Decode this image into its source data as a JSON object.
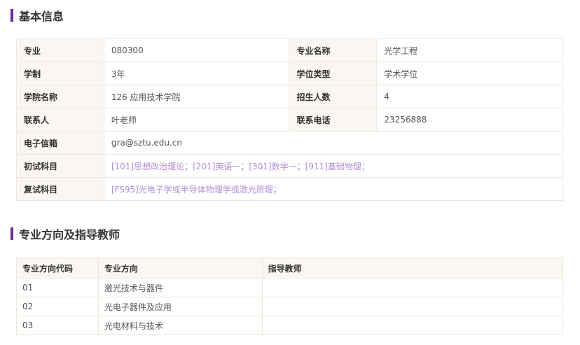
{
  "basic": {
    "title": "基本信息",
    "rows": [
      {
        "l1": "专业",
        "v1": "080300",
        "l2": "专业名称",
        "v2": "光学工程"
      },
      {
        "l1": "学制",
        "v1": "3年",
        "l2": "学位类型",
        "v2": "学术学位"
      },
      {
        "l1": "学院名称",
        "v1": "126 应用技术学院",
        "l2": "招生人数",
        "v2": "4"
      },
      {
        "l1": "联系人",
        "v1": "叶老师",
        "l2": "联系电话",
        "v2": "23256888"
      }
    ],
    "email_label": "电子信箱",
    "email": "gra@sztu.edu.cn",
    "prelim_label": "初试科目",
    "prelim_subjects": [
      "[101]思想政治理论",
      "[201]英语一",
      "[301]数学一",
      "[911]基础物理"
    ],
    "retest_label": "复试科目",
    "retest_subjects": [
      "[FS95]光电子学或半导体物理学或激光原理"
    ]
  },
  "directions": {
    "title": "专业方向及指导教师",
    "headers": [
      "专业方向代码",
      "专业方向",
      "指导教师"
    ],
    "rows": [
      {
        "code": "01",
        "name": "激光技术与器件",
        "advisor": ""
      },
      {
        "code": "02",
        "name": "光电子器件及应用",
        "advisor": ""
      },
      {
        "code": "03",
        "name": "光电材料与技术",
        "advisor": ""
      }
    ]
  },
  "colors": {
    "accent": "#6b2c91",
    "link": "#b48ed3",
    "label_bg": "#faf6f1",
    "border": "#f0e6da"
  }
}
